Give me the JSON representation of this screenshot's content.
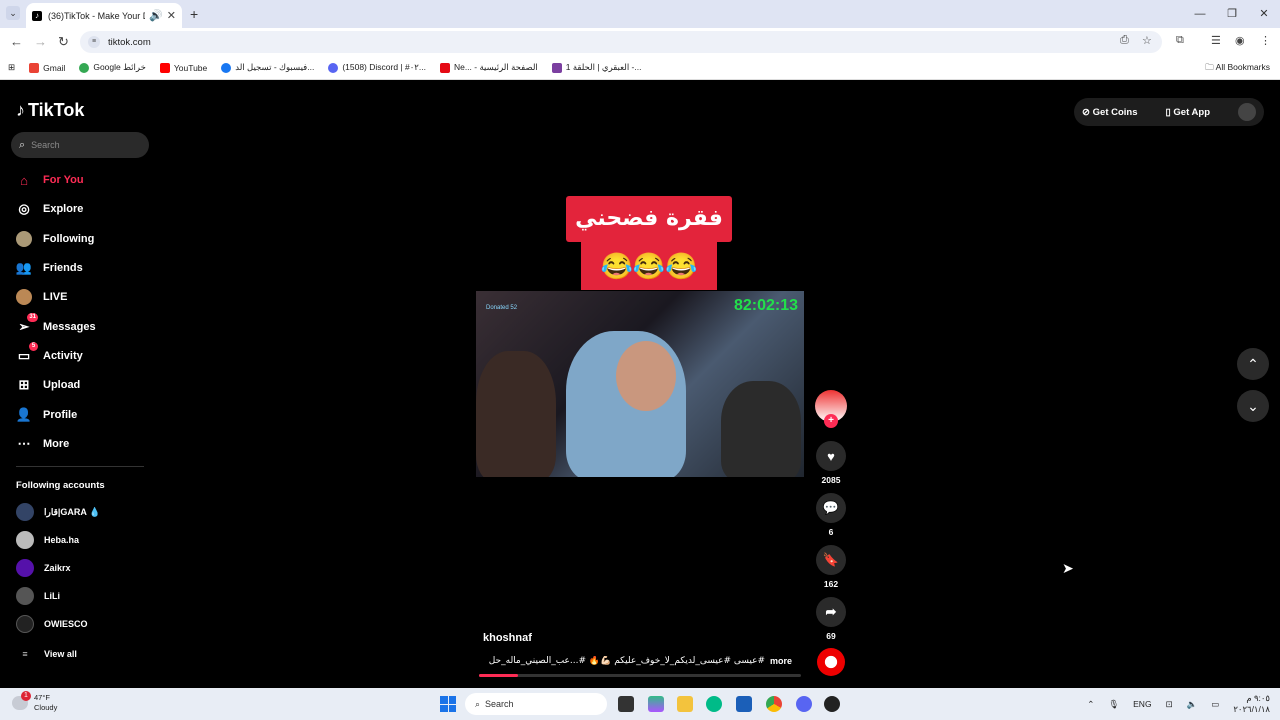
{
  "browser": {
    "tab_title": "(36)TikTok - Make Your Day",
    "url": "tiktok.com",
    "bookmarks": [
      "Gmail",
      "Google خرائط",
      "YouTube",
      "فيسبوك - تسجيل الد...",
      "(1508) Discord | #٠٢...",
      "Ne... - الصفحة الرئيسية",
      "العبقري | الحلقة 1 -..."
    ],
    "all_bookmarks": "All Bookmarks"
  },
  "app": {
    "logo": "TikTok",
    "search_placeholder": "Search",
    "nav": [
      {
        "label": "For You",
        "icon": "home-icon"
      },
      {
        "label": "Explore",
        "icon": "compass-icon"
      },
      {
        "label": "Following",
        "icon": "following-avatar-icon"
      },
      {
        "label": "Friends",
        "icon": "friends-icon"
      },
      {
        "label": "LIVE",
        "icon": "live-icon"
      },
      {
        "label": "Messages",
        "icon": "messages-icon",
        "badge": "31"
      },
      {
        "label": "Activity",
        "icon": "activity-icon",
        "badge": "5"
      },
      {
        "label": "Upload",
        "icon": "upload-icon"
      },
      {
        "label": "Profile",
        "icon": "profile-icon"
      },
      {
        "label": "More",
        "icon": "more-icon"
      }
    ],
    "following_title": "Following accounts",
    "following_accounts": [
      "قارا|GARA 💧",
      "Heba.ha",
      "Zaikrx",
      "LiLi",
      "OWIESCO"
    ],
    "view_all": "View all",
    "get_coins": "Get Coins",
    "get_app": "Get App"
  },
  "video": {
    "caption_line1": "فقرة فضحني",
    "caption_line2": "😂😂😂",
    "timer": "82:02:13",
    "donated": "Donated 52",
    "username": "khoshnaf",
    "description": "#عيسى #عيسى_لديكم_لا_خوف_عليكم 💪🏻🔥 #...عب_الصيني_ماله_حل",
    "more": "more",
    "likes": "2085",
    "comments": "6",
    "saves": "162",
    "shares": "69",
    "progress": 0.12
  },
  "taskbar": {
    "temp": "47°F",
    "condition": "Cloudy",
    "weather_badge": "1",
    "search": "Search",
    "lang": "ENG",
    "time": "٩:٠٥ م",
    "date": "٢٠٢٦/١/١٨"
  },
  "colors": {
    "accent": "#fe2c55",
    "caption_bg": "#e3243b",
    "timer": "#22e04b"
  }
}
